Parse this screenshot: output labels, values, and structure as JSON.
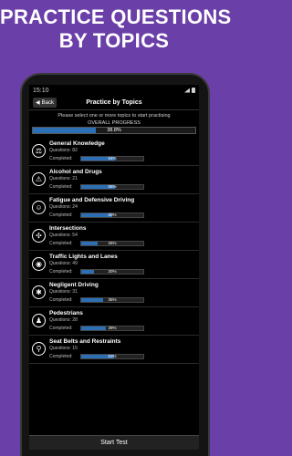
{
  "promo": {
    "line1": "PRACTICE QUESTIONS",
    "line2": "BY TOPICS"
  },
  "status_bar": {
    "time": "15:10"
  },
  "app_bar": {
    "back_label": "Back",
    "title": "Practice by Topics"
  },
  "instructions": "Please select one or more topics to start practising",
  "overall": {
    "label": "OVERALL PROGRESS",
    "percent_text": "38.8%",
    "percent": 38.8
  },
  "questions_label": "Questions:",
  "completed_label": "Completed:",
  "topics": [
    {
      "name": "General Knowledge",
      "icon": "gavel-icon",
      "questions": "82",
      "completed": "54%",
      "percent": 54
    },
    {
      "name": "Alcohol and Drugs",
      "icon": "warning-icon",
      "questions": "21",
      "completed": "55%",
      "percent": 55
    },
    {
      "name": "Fatigue and Defensive Driving",
      "icon": "face-icon",
      "questions": "24",
      "completed": "50%",
      "percent": 50
    },
    {
      "name": "Intersections",
      "icon": "intersection-icon",
      "questions": "54",
      "completed": "26%",
      "percent": 26
    },
    {
      "name": "Traffic Lights and Lanes",
      "icon": "traffic-light-icon",
      "questions": "49",
      "completed": "20%",
      "percent": 20
    },
    {
      "name": "Negligent Driving",
      "icon": "car-crash-icon",
      "questions": "31",
      "completed": "35%",
      "percent": 35
    },
    {
      "name": "Pedestrians",
      "icon": "pedestrian-icon",
      "questions": "28",
      "completed": "39%",
      "percent": 39
    },
    {
      "name": "Seat Belts and Restraints",
      "icon": "seat-belt-icon",
      "questions": "15",
      "completed": "53%",
      "percent": 53
    }
  ],
  "start_button": "Start Test"
}
